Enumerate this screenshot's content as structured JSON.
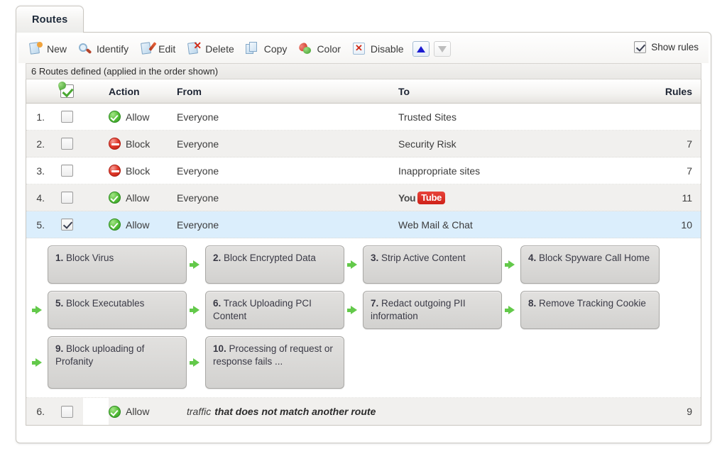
{
  "tab": {
    "label": "Routes"
  },
  "toolbar": {
    "buttons": [
      {
        "label": "New",
        "icon": "new-document-icon"
      },
      {
        "label": "Identify",
        "icon": "magnifier-identify-icon"
      },
      {
        "label": "Edit",
        "icon": "edit-pencil-icon"
      },
      {
        "label": "Delete",
        "icon": "delete-x-icon"
      },
      {
        "label": "Copy",
        "icon": "copy-pages-icon"
      },
      {
        "label": "Color",
        "icon": "color-palette-icon"
      },
      {
        "label": "Disable",
        "icon": "disable-x-icon"
      }
    ],
    "move_up": {
      "icon": "triangle-up-icon",
      "enabled": true
    },
    "move_down": {
      "icon": "triangle-down-icon",
      "enabled": false
    },
    "show_rules": {
      "label": "Show rules",
      "checked": true
    }
  },
  "caption": "6 Routes defined (applied in the order shown)",
  "table": {
    "headers": {
      "select_icon": "green-check-select-icon",
      "action": "Action",
      "from": "From",
      "to": "To",
      "rules": "Rules"
    },
    "rows": [
      {
        "num": "1.",
        "checked": false,
        "action": "Allow",
        "action_type": "allow",
        "from": "Everyone",
        "to": "Trusted Sites",
        "to_kind": "text",
        "rules": "",
        "selected": false
      },
      {
        "num": "2.",
        "checked": false,
        "action": "Block",
        "action_type": "block",
        "from": "Everyone",
        "to": "Security Risk",
        "to_kind": "text",
        "rules": "7",
        "selected": false
      },
      {
        "num": "3.",
        "checked": false,
        "action": "Block",
        "action_type": "block",
        "from": "Everyone",
        "to": "Inappropriate sites",
        "to_kind": "text",
        "rules": "7",
        "selected": false
      },
      {
        "num": "4.",
        "checked": false,
        "action": "Allow",
        "action_type": "allow",
        "from": "Everyone",
        "to": "YouTube",
        "to_kind": "youtube",
        "to_logo_word1": "You",
        "to_logo_word2": "Tube",
        "rules": "11",
        "selected": false
      },
      {
        "num": "5.",
        "checked": true,
        "action": "Allow",
        "action_type": "allow",
        "from": "Everyone",
        "to": "Web Mail & Chat",
        "to_kind": "text",
        "rules": "10",
        "selected": true
      }
    ],
    "default_row": {
      "num": "6.",
      "checked": false,
      "action": "Allow",
      "action_type": "allow",
      "text_plain": "traffic",
      "text_bold": "that does not match another route",
      "rules": "9"
    }
  },
  "rules_flow": {
    "steps": [
      {
        "num": "1.",
        "text": "Block Virus"
      },
      {
        "num": "2.",
        "text": "Block Encrypted Data"
      },
      {
        "num": "3.",
        "text": "Strip Active Content"
      },
      {
        "num": "4.",
        "text": "Block Spyware Call Home"
      },
      {
        "num": "5.",
        "text": "Block Executables"
      },
      {
        "num": "6.",
        "text": "Track Uploading PCI Content"
      },
      {
        "num": "7.",
        "text": "Redact outgoing PII information"
      },
      {
        "num": "8.",
        "text": "Remove Tracking Cookie"
      },
      {
        "num": "9.",
        "text": "Block uploading of Profanity"
      },
      {
        "num": "10.",
        "text": "Processing of request or response fails ..."
      }
    ]
  },
  "colors": {
    "allow": "#4aa832",
    "block": "#d12b18",
    "selection": "#dbeefc",
    "arrow": "#63c94a"
  }
}
